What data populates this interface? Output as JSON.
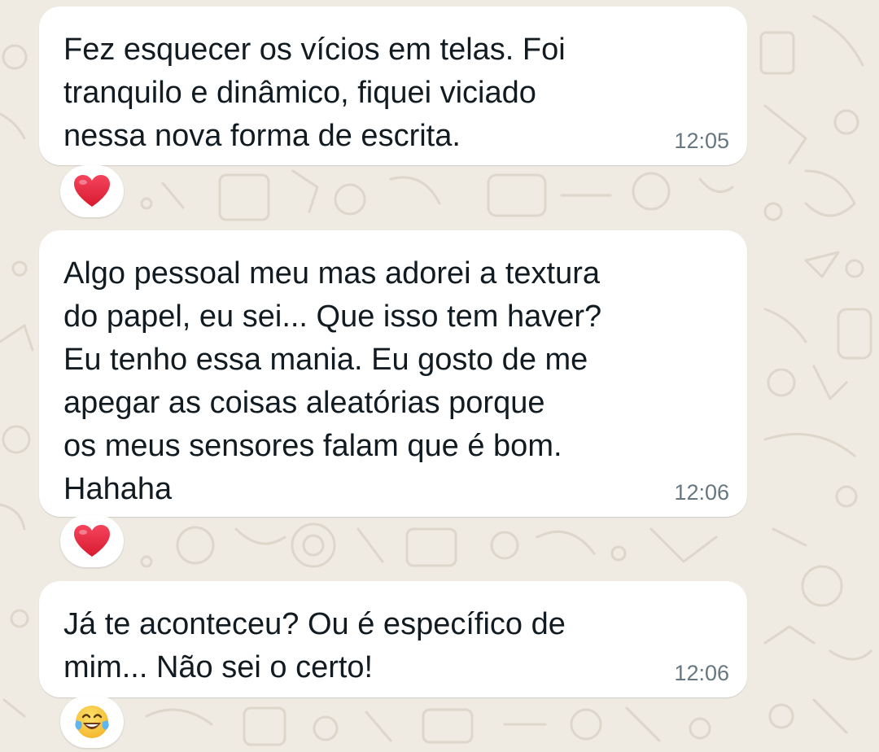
{
  "chat": {
    "messages": [
      {
        "text": "Fez esquecer os vícios em telas. Foi\ntranquilo e dinâmico, fiquei viciado\nnessa nova forma de escrita.",
        "time": "12:05",
        "reaction": {
          "icon": "heart-icon",
          "color": "#e0243a"
        }
      },
      {
        "text": "Algo pessoal meu mas adorei a textura\ndo papel, eu sei... Que isso tem haver?\nEu tenho essa mania. Eu gosto de me\napegar as coisas aleatórias porque\nos meus sensores falam que é bom.\nHahaha",
        "time": "12:06",
        "reaction": {
          "icon": "heart-icon",
          "color": "#e0243a"
        }
      },
      {
        "text": "Já te aconteceu? Ou é específico de\nmim... Não sei o certo!",
        "time": "12:06",
        "reaction": {
          "icon": "face-with-tears-of-joy-icon",
          "color": "#f5c33b"
        }
      }
    ]
  },
  "theme": {
    "background": "#efeae2",
    "bubble": "#ffffff",
    "text": "#111b21",
    "timestamp": "#667781"
  }
}
